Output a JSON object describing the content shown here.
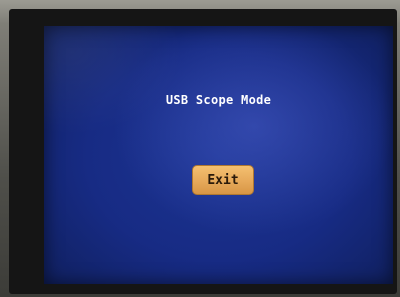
{
  "screen": {
    "title": "USB Scope Mode",
    "exit_label": "Exit"
  },
  "colors": {
    "screen_background": "#172b84",
    "title_text": "#ffffff",
    "button_fill": "#e6a95a",
    "button_text": "#2a1a0a"
  }
}
